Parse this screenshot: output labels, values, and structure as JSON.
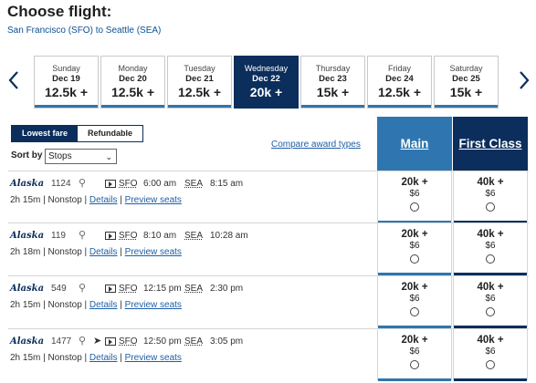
{
  "header": {
    "title": "Choose flight:",
    "route": "San Francisco (SFO) to Seattle (SEA)"
  },
  "dates": [
    {
      "dow": "Sunday",
      "day": "Dec 19",
      "price": "12.5k +",
      "selected": false
    },
    {
      "dow": "Monday",
      "day": "Dec 20",
      "price": "12.5k +",
      "selected": false
    },
    {
      "dow": "Tuesday",
      "day": "Dec 21",
      "price": "12.5k +",
      "selected": false
    },
    {
      "dow": "Wednesday",
      "day": "Dec 22",
      "price": "20k +",
      "selected": true
    },
    {
      "dow": "Thursday",
      "day": "Dec 23",
      "price": "15k +",
      "selected": false
    },
    {
      "dow": "Friday",
      "day": "Dec 24",
      "price": "12.5k +",
      "selected": false
    },
    {
      "dow": "Saturday",
      "day": "Dec 25",
      "price": "15k +",
      "selected": false
    }
  ],
  "filters": {
    "lowest_fare": "Lowest fare",
    "refundable": "Refundable",
    "sort_label": "Sort by",
    "sort_value": "Stops",
    "compare_link": "Compare award types"
  },
  "columns": {
    "main": "Main",
    "first": "First Class"
  },
  "flights": [
    {
      "airline": "Alaska",
      "number": "1124",
      "orig": "SFO",
      "dep": "6:00 am",
      "dest": "SEA",
      "arr": "8:15 am",
      "duration": "2h 15m",
      "stops": "Nonstop",
      "details": "Details",
      "preview": "Preview seats",
      "main_pts": "20k +",
      "main_cash": "$6",
      "first_pts": "40k +",
      "first_cash": "$6"
    },
    {
      "airline": "Alaska",
      "number": "119",
      "orig": "SFO",
      "dep": "8:10 am",
      "dest": "SEA",
      "arr": "10:28 am",
      "duration": "2h 18m",
      "stops": "Nonstop",
      "details": "Details",
      "preview": "Preview seats",
      "main_pts": "20k +",
      "main_cash": "$6",
      "first_pts": "40k +",
      "first_cash": "$6"
    },
    {
      "airline": "Alaska",
      "number": "549",
      "orig": "SFO",
      "dep": "12:15 pm",
      "dest": "SEA",
      "arr": "2:30 pm",
      "duration": "2h 15m",
      "stops": "Nonstop",
      "details": "Details",
      "preview": "Preview seats",
      "main_pts": "20k +",
      "main_cash": "$6",
      "first_pts": "40k +",
      "first_cash": "$6"
    },
    {
      "airline": "Alaska",
      "number": "1477",
      "orig": "SFO",
      "dep": "12:50 pm",
      "dest": "SEA",
      "arr": "3:05 pm",
      "duration": "2h 15m",
      "stops": "Nonstop",
      "details": "Details",
      "preview": "Preview seats",
      "main_pts": "20k +",
      "main_cash": "$6",
      "first_pts": "40k +",
      "first_cash": "$6"
    }
  ],
  "icons": [
    "chevron-left-icon",
    "chevron-right-icon",
    "wifi-icon",
    "power-icon",
    "entertainment-icon",
    "caret-down-icon"
  ],
  "colors": {
    "navy": "#0b2e5c",
    "blue": "#2f76b0",
    "link": "#1f5fa6"
  }
}
